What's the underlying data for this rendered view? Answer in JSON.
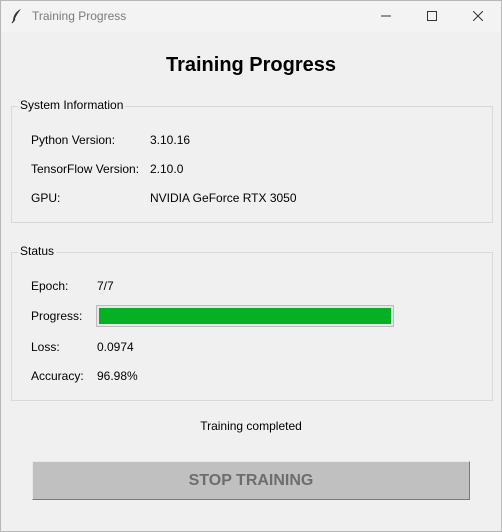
{
  "window": {
    "title": "Training Progress",
    "icons": {
      "app": "feather-icon",
      "minimize": "minimize-icon",
      "maximize": "maximize-icon",
      "close": "close-icon"
    }
  },
  "heading": "Training Progress",
  "system_info": {
    "title": "System Information",
    "rows": [
      {
        "label": "Python Version:",
        "value": "3.10.16"
      },
      {
        "label": "TensorFlow Version:",
        "value": "2.10.0"
      },
      {
        "label": "GPU:",
        "value": "NVIDIA GeForce RTX 3050"
      }
    ]
  },
  "status": {
    "title": "Status",
    "epoch_label": "Epoch:",
    "epoch_value": "7/7",
    "progress_label": "Progress:",
    "progress_fraction": 1.0,
    "loss_label": "Loss:",
    "loss_value": "0.0974",
    "accuracy_label": "Accuracy:",
    "accuracy_value": "96.98%"
  },
  "status_message": "Training completed",
  "stop_button": {
    "label": "STOP TRAINING",
    "enabled": false
  },
  "colors": {
    "progress_fill": "#06b025",
    "button_disabled_bg": "#c0c0c0",
    "button_disabled_text": "#6d6d6d",
    "window_bg": "#f0f0f0"
  }
}
